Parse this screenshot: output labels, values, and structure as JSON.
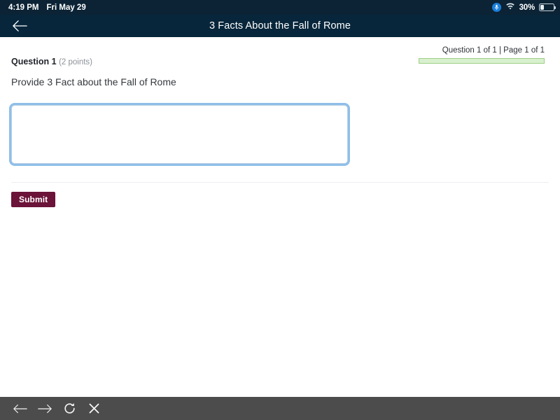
{
  "statusbar": {
    "time": "4:19 PM",
    "date": "Fri May 29",
    "mic_icon": "microphone-recording-icon",
    "wifi_icon": "wifi-icon",
    "battery_percent": "30%",
    "battery_level": 30,
    "battery_icon": "battery-icon"
  },
  "appbar": {
    "back_icon": "arrow-left-icon",
    "title": "3 Facts About the Fall of Rome"
  },
  "progress": {
    "label": "Question 1 of 1 | Page 1 of 1",
    "percent": 100,
    "fill_color": "#d9f0cf",
    "border_color": "#9ccf86"
  },
  "question": {
    "number_label": "Question 1",
    "points_label": "(2 points)",
    "prompt": "Provide 3 Fact about the Fall of Rome",
    "answer_value": "",
    "answer_placeholder": ""
  },
  "actions": {
    "submit_label": "Submit",
    "submit_color": "#6b1338"
  },
  "bottombar": {
    "tools": [
      {
        "name": "nav-back-icon",
        "label": "Back"
      },
      {
        "name": "nav-forward-icon",
        "label": "Forward"
      },
      {
        "name": "nav-reload-icon",
        "label": "Reload"
      },
      {
        "name": "nav-stop-icon",
        "label": "Stop"
      }
    ]
  }
}
